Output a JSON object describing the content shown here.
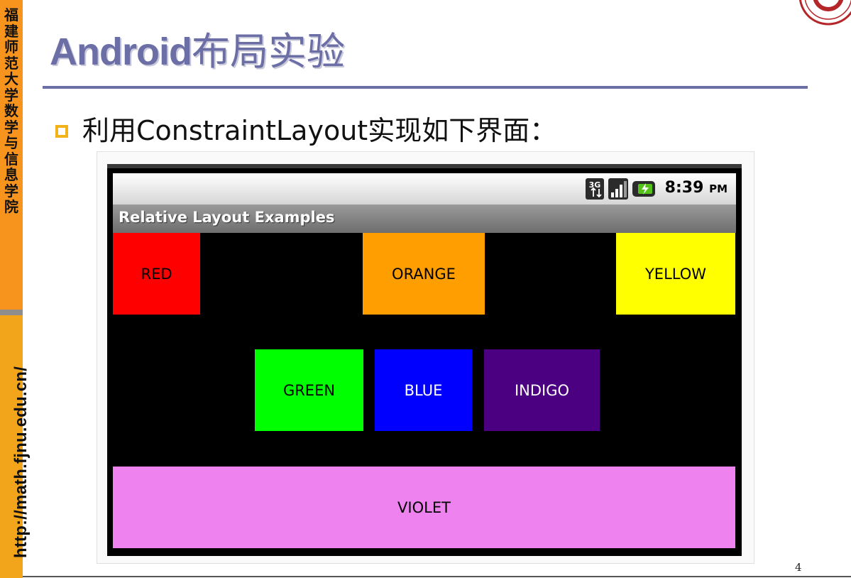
{
  "sidebar": {
    "school_name": "福建师范大学数学与信息学院",
    "url": "http://math.fjnu.edu.cn/"
  },
  "title": {
    "en": "Android",
    "cn": "布局实验"
  },
  "bullet": {
    "text": "利用ConstraintLayout实现如下界面："
  },
  "phone": {
    "status_bar": {
      "time": "8:39",
      "ampm": "PM",
      "network": "3G"
    },
    "app_title": "Relative Layout Examples",
    "tiles": {
      "red": {
        "label": "RED",
        "color": "#ff0000"
      },
      "orange": {
        "label": "ORANGE",
        "color": "#ff9e00"
      },
      "yellow": {
        "label": "YELLOW",
        "color": "#ffff00"
      },
      "green": {
        "label": "GREEN",
        "color": "#00ff00"
      },
      "blue": {
        "label": "BLUE",
        "color": "#0000ff"
      },
      "indigo": {
        "label": "INDIGO",
        "color": "#4b0082"
      },
      "violet": {
        "label": "VIOLET",
        "color": "#ee82ee"
      }
    }
  },
  "page_number": "4",
  "colors": {
    "sidebar": "#f7941d",
    "title": "#6b6fa6",
    "bullet": "#f2b31a"
  }
}
